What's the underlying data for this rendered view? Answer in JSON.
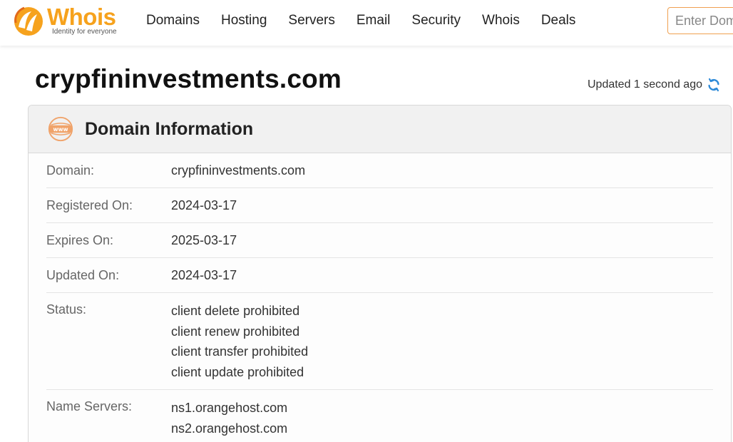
{
  "brand": {
    "name": "Whois",
    "tagline": "Identity for everyone",
    "accent": "#f6a21d"
  },
  "nav": {
    "items": [
      "Domains",
      "Hosting",
      "Servers",
      "Email",
      "Security",
      "Whois",
      "Deals"
    ]
  },
  "search": {
    "placeholder": "Enter Domain"
  },
  "page": {
    "title": "crypfininvestments.com",
    "updated": "Updated 1 second ago"
  },
  "card": {
    "title": "Domain Information",
    "icon": "www-icon",
    "rows": [
      {
        "label": "Domain:",
        "values": [
          "crypfininvestments.com"
        ]
      },
      {
        "label": "Registered On:",
        "values": [
          "2024-03-17"
        ]
      },
      {
        "label": "Expires On:",
        "values": [
          "2025-03-17"
        ]
      },
      {
        "label": "Updated On:",
        "values": [
          "2024-03-17"
        ]
      },
      {
        "label": "Status:",
        "values": [
          "client delete prohibited",
          "client renew prohibited",
          "client transfer prohibited",
          "client update prohibited"
        ]
      },
      {
        "label": "Name Servers:",
        "values": [
          "ns1.orangehost.com",
          "ns2.orangehost.com"
        ]
      }
    ]
  }
}
